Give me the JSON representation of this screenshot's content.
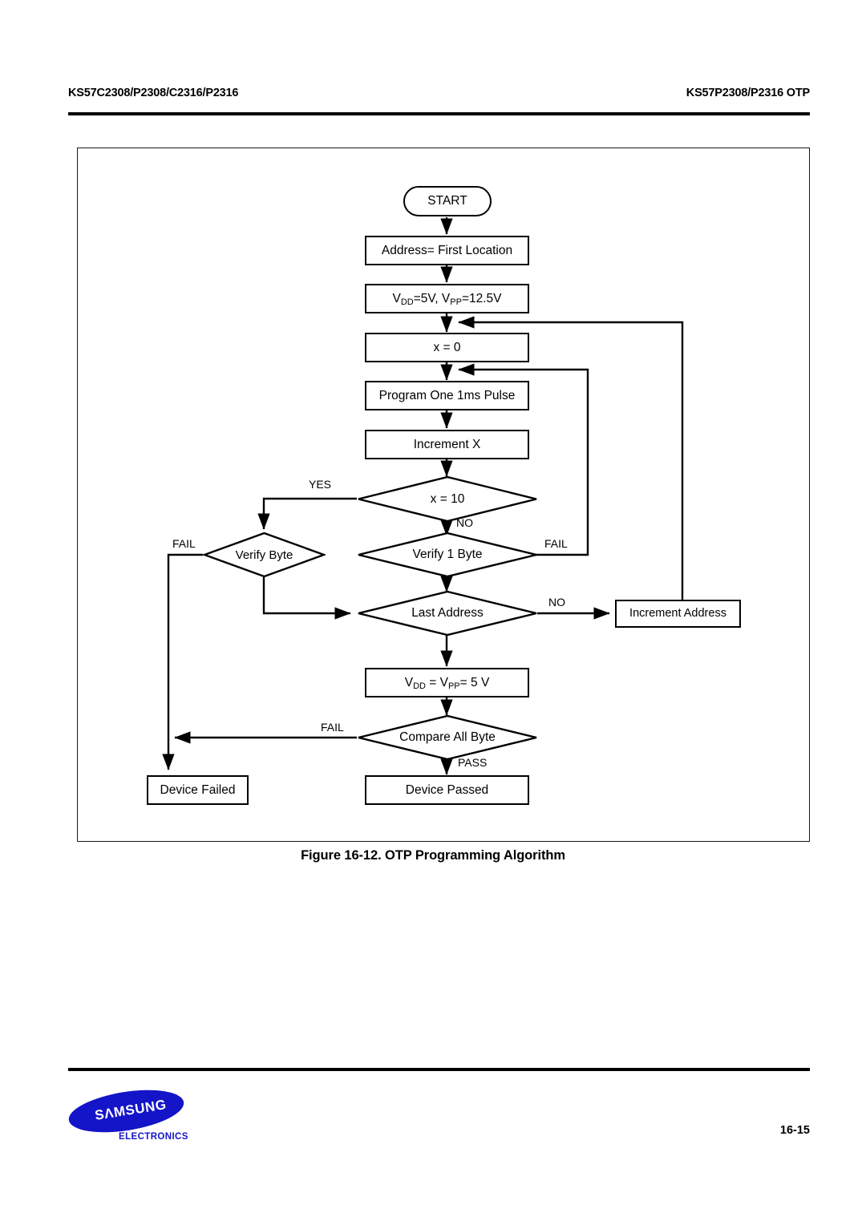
{
  "header": {
    "left_title": "KS57C2308/P2308/C2316/P2316",
    "right_title": "KS57P2308/P2316 OTP"
  },
  "figure": {
    "caption": "Figure 16-12. OTP Programming Algorithm",
    "nodes": {
      "start": "START",
      "address_first": "Address= First Location",
      "set_voltages_pre": "V",
      "set_voltages_dd": "DD",
      "set_voltages_mid": "=5V, V",
      "set_voltages_pp": "PP",
      "set_voltages_post": "=12.5V",
      "x_zero": "x = 0",
      "program_pulse": "Program One 1ms Pulse",
      "increment_x": "Increment X",
      "x_equals_10": "x = 10",
      "verify_byte": "Verify Byte",
      "verify_1_byte": "Verify 1 Byte",
      "last_address": "Last Address",
      "increment_address": "Increment Address",
      "final_voltages_pre": "V",
      "final_voltages_dd": "DD",
      "final_voltages_mid": " = V",
      "final_voltages_pp": "PP",
      "final_voltages_post": "= 5 V",
      "compare_all_byte": "Compare All Byte",
      "device_failed": "Device Failed",
      "device_passed": "Device Passed"
    },
    "edge_labels": {
      "yes_x10": "YES",
      "no_x10": "NO",
      "fail_verify_byte": "FAIL",
      "fail_verify_1_byte": "FAIL",
      "no_last_address": "NO",
      "fail_compare": "FAIL",
      "pass_compare": "PASS"
    }
  },
  "footer": {
    "logo_wordmark": "SΛMSUNG",
    "logo_sub": "ELECTRONICS",
    "page_number": "16-15"
  }
}
